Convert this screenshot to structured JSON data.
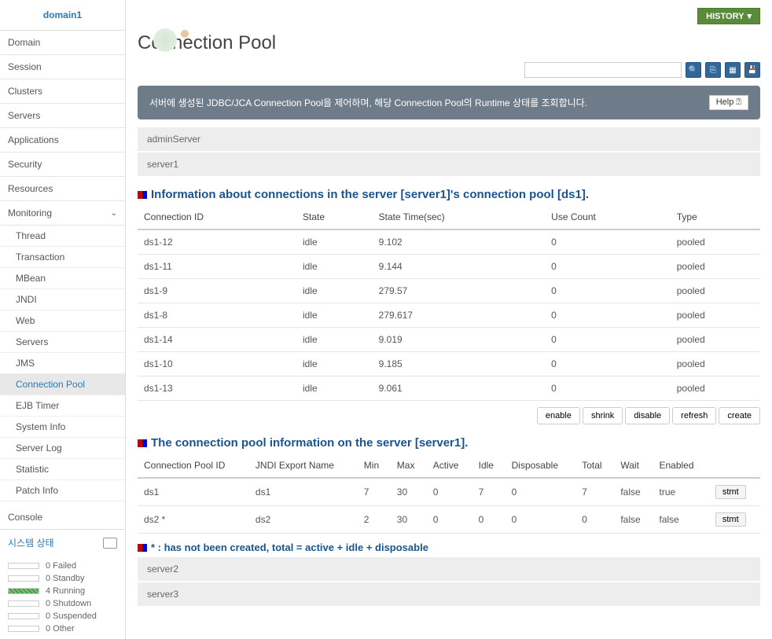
{
  "sidebar": {
    "title": "domain1",
    "nav": [
      "Domain",
      "Session",
      "Clusters",
      "Servers",
      "Applications",
      "Security",
      "Resources"
    ],
    "monitoring": {
      "label": "Monitoring",
      "items": [
        "Thread",
        "Transaction",
        "MBean",
        "JNDI",
        "Web",
        "Servers",
        "JMS",
        "Connection Pool",
        "EJB Timer",
        "System Info",
        "Server Log",
        "Statistic",
        "Patch Info"
      ]
    },
    "console": "Console",
    "system_status": "시스템 상태",
    "statuses": [
      {
        "count": "0",
        "label": "Failed"
      },
      {
        "count": "0",
        "label": "Standby"
      },
      {
        "count": "4",
        "label": "Running"
      },
      {
        "count": "0",
        "label": "Shutdown"
      },
      {
        "count": "0",
        "label": "Suspended"
      },
      {
        "count": "0",
        "label": "Other"
      }
    ]
  },
  "main": {
    "history": "HISTORY",
    "title": "Connection Pool",
    "banner": "서버에 생성된 JDBC/JCA Connection Pool을 제어하며, 해당 Connection Pool의 Runtime 상태를 조회합니다.",
    "help": "Help",
    "servers_top": [
      "adminServer",
      "server1"
    ],
    "section1_title": "Information about connections in the server [server1]'s connection pool [ds1].",
    "table1_headers": [
      "Connection ID",
      "State",
      "State Time(sec)",
      "Use Count",
      "Type"
    ],
    "table1_rows": [
      {
        "id": "ds1-12",
        "state": "idle",
        "time": "9.102",
        "use": "0",
        "type": "pooled"
      },
      {
        "id": "ds1-11",
        "state": "idle",
        "time": "9.144",
        "use": "0",
        "type": "pooled"
      },
      {
        "id": "ds1-9",
        "state": "idle",
        "time": "279.57",
        "use": "0",
        "type": "pooled"
      },
      {
        "id": "ds1-8",
        "state": "idle",
        "time": "279.617",
        "use": "0",
        "type": "pooled"
      },
      {
        "id": "ds1-14",
        "state": "idle",
        "time": "9.019",
        "use": "0",
        "type": "pooled"
      },
      {
        "id": "ds1-10",
        "state": "idle",
        "time": "9.185",
        "use": "0",
        "type": "pooled"
      },
      {
        "id": "ds1-13",
        "state": "idle",
        "time": "9.061",
        "use": "0",
        "type": "pooled"
      }
    ],
    "buttons": [
      "enable",
      "shrink",
      "disable",
      "refresh",
      "create"
    ],
    "section2_title": "The connection pool information on the server [server1].",
    "table2_headers": [
      "Connection Pool ID",
      "JNDI Export Name",
      "Min",
      "Max",
      "Active",
      "Idle",
      "Disposable",
      "Total",
      "Wait",
      "Enabled",
      ""
    ],
    "table2_rows": [
      {
        "id": "ds1",
        "jndi": "ds1",
        "min": "7",
        "max": "30",
        "active": "0",
        "idle": "7",
        "disp": "0",
        "total": "7",
        "wait": "false",
        "enabled": "true",
        "btn": "stmt"
      },
      {
        "id": "ds2 *",
        "jndi": "ds2",
        "min": "2",
        "max": "30",
        "active": "0",
        "idle": "0",
        "disp": "0",
        "total": "0",
        "wait": "false",
        "enabled": "false",
        "btn": "stmt"
      }
    ],
    "note": "* : has not been created, total = active + idle + disposable",
    "servers_bottom": [
      "server2",
      "server3"
    ]
  }
}
